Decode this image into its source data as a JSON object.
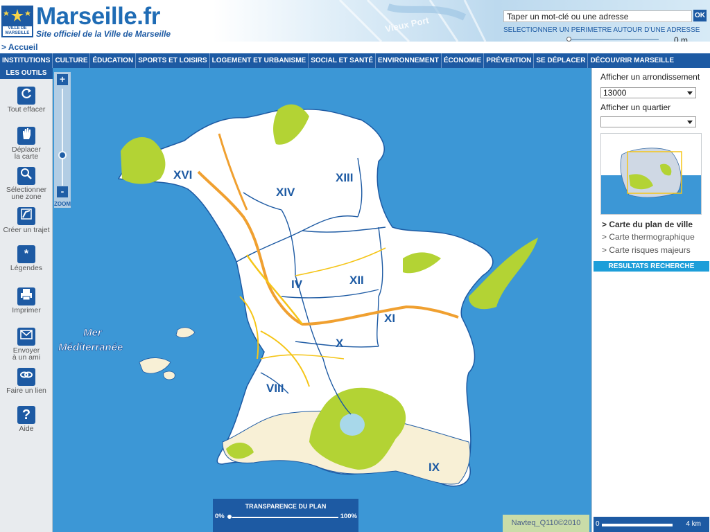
{
  "header": {
    "logo_text": "VILLE DE MARSEILLE",
    "title": "Marseille.fr",
    "subtitle": "Site officiel de la Ville de Marseille",
    "harbor_label": "Vieux Port",
    "search_value": "Taper un mot-clé ou une adresse",
    "search_button": "OK",
    "perimeter_label": "SELECTIONNER UN PERIMETRE AUTOUR D'UNE ADRESSE",
    "perimeter_value": "0 m"
  },
  "breadcrumb": "> Accueil",
  "nav": {
    "items": [
      "INSTITUTIONS",
      "CULTURE",
      "ÉDUCATION",
      "SPORTS ET LOISIRS",
      "LOGEMENT ET URBANISME",
      "SOCIAL ET SANTÉ",
      "ENVIRONNEMENT",
      "ÉCONOMIE",
      "PRÉVENTION",
      "SE DÉPLACER",
      "DÉCOUVRIR MARSEILLE"
    ]
  },
  "tools": {
    "header": "LES OUTILS",
    "items": [
      {
        "label1": "Tout effacer",
        "label2": "",
        "icon": "refresh-icon"
      },
      {
        "label1": "Déplacer",
        "label2": "la carte",
        "icon": "hand-icon"
      },
      {
        "label1": "Sélectionner",
        "label2": "une zone",
        "icon": "zoom-select-icon"
      },
      {
        "label1": "Créer un trajet",
        "label2": "",
        "icon": "route-icon"
      },
      {
        "label1": "Légendes",
        "label2": "",
        "icon": "legend-icon"
      },
      {
        "label1": "Imprimer",
        "label2": "",
        "icon": "printer-icon"
      },
      {
        "label1": "Envoyer",
        "label2": "à un ami",
        "icon": "mail-icon"
      },
      {
        "label1": "Faire un lien",
        "label2": "",
        "icon": "link-icon"
      },
      {
        "label1": "Aide",
        "label2": "",
        "icon": "help-icon"
      }
    ]
  },
  "map": {
    "zoom_in": "+",
    "zoom_out": "-",
    "zoom_label": "ZOOM",
    "sea_label_1": "Mer",
    "sea_label_2": "Méditerranée",
    "districts": [
      "XVI",
      "XIV",
      "XIII",
      "IV",
      "XII",
      "XI",
      "X",
      "VIII",
      "IX"
    ],
    "transparency_title": "TRANSPARENCE DU PLAN",
    "transparency_min": "0%",
    "transparency_max": "100%",
    "copyright": "Navteq_Q110©2010"
  },
  "right_panel": {
    "arrondissement_label": "Afficher un arrondissement",
    "arrondissement_value": "13000",
    "quartier_label": "Afficher un quartier",
    "quartier_value": "",
    "links": [
      "> Carte du plan de ville",
      "> Carte thermographique",
      "> Carte risques majeurs"
    ],
    "active_link": 0,
    "results_header": "RESULTATS RECHERCHE",
    "scale_min": "0",
    "scale_max": "4 km"
  },
  "colors": {
    "brand_blue": "#1d5aa3",
    "sea": "#3c97d6",
    "land": "#ffffff",
    "green": "#b3d334",
    "road": "#f5c518",
    "highway": "#f0a030",
    "boundary": "#1d5aa3"
  }
}
